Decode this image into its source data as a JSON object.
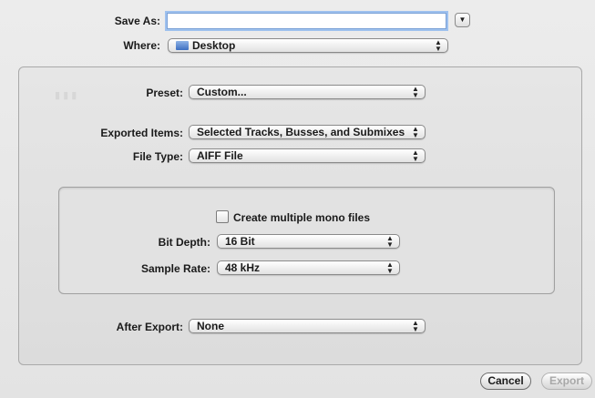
{
  "save_as": {
    "label": "Save As:",
    "value": "",
    "disclosure_icon": "triangle-down"
  },
  "where": {
    "label": "Where:",
    "value": "Desktop",
    "icon": "folder-icon"
  },
  "preset": {
    "label": "Preset:",
    "value": "Custom..."
  },
  "exported_items": {
    "label": "Exported Items:",
    "value": "Selected Tracks, Busses, and Submixes"
  },
  "file_type": {
    "label": "File Type:",
    "value": "AIFF File"
  },
  "mono": {
    "label": "Create multiple mono files",
    "checked": false
  },
  "bit_depth": {
    "label": "Bit Depth:",
    "value": "16 Bit"
  },
  "sample_rate": {
    "label": "Sample Rate:",
    "value": "48 kHz"
  },
  "after_export": {
    "label": "After Export:",
    "value": "None"
  },
  "buttons": {
    "cancel": "Cancel",
    "export": "Export"
  },
  "colors": {
    "focus_ring": "#9ec1ee",
    "sheet_bg": "#e9e9e9",
    "disabled_text": "#a8a8a8"
  }
}
